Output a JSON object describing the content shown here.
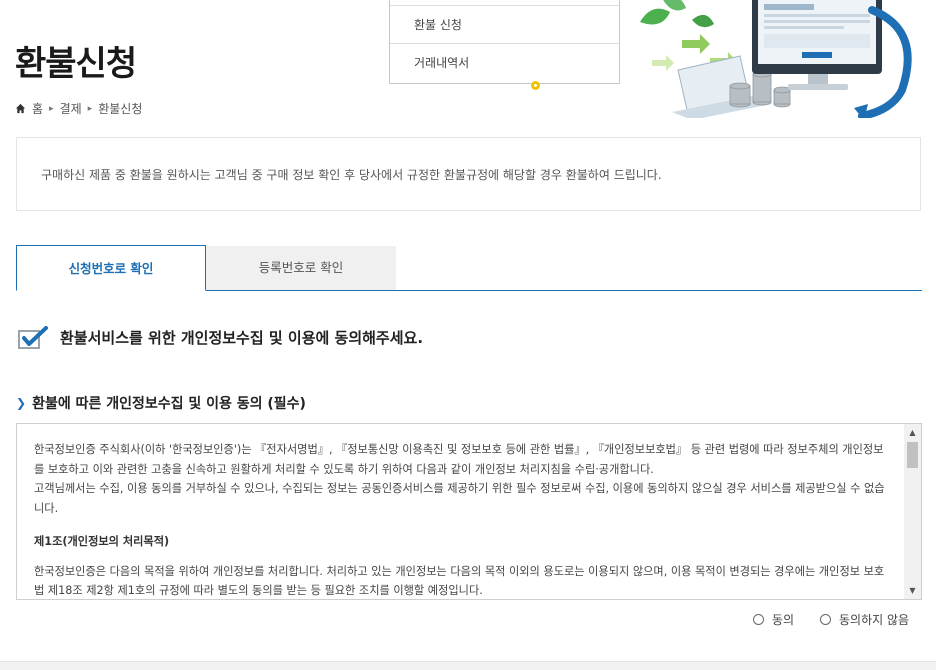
{
  "dropdown": {
    "items": [
      "환불 신청",
      "거래내역서"
    ]
  },
  "page": {
    "title": "환불신청"
  },
  "breadcrumb": {
    "items": [
      "홈",
      "결제",
      "환불신청"
    ]
  },
  "notice": {
    "text": "구매하신 제품 중 환불을 원하시는 고객님 중 구매 정보 확인 후 당사에서 규정한 환불규정에 해당할 경우 환불하여 드립니다."
  },
  "tabs": [
    {
      "label": "신청번호로 확인",
      "active": true
    },
    {
      "label": "등록번호로 확인",
      "active": false
    }
  ],
  "consent": {
    "title": "환불서비스를 위한 개인정보수집 및 이용에 동의해주세요."
  },
  "section": {
    "title": "환불에 따른 개인정보수집 및 이용 동의 (필수)"
  },
  "policy": {
    "para1": "한국정보인증 주식회사(이하 '한국정보인증')는 『전자서명법』, 『정보통신망 이용촉진 및 정보보호 등에 관한 법률』, 『개인정보보호법』 등 관련 법령에 따라 정보주체의 개인정보를 보호하고 이와 관련한 고충을 신속하고 원활하게 처리할 수 있도록 하기 위하여 다음과 같이 개인정보 처리지침을 수립·공개합니다.",
    "para2": "고객님께서는 수집, 이용 동의를 거부하실 수 있으나, 수집되는 정보는 공동인증서비스를 제공하기 위한 필수 정보로써 수집, 이용에 동의하지 않으실 경우 서비스를 제공받으실 수 없습니다.",
    "heading1": "제1조(개인정보의 처리목적)",
    "para3": "한국정보인증은 다음의 목적을 위하여 개인정보를 처리합니다. 처리하고 있는 개인정보는 다음의 목적 이외의 용도로는 이용되지 않으며, 이용 목적이 변경되는 경우에는 개인정보 보호법 제18조 제2항 제1호의 규정에 따라 별도의 동의를 받는 등 필요한 조치를 이행할 예정입니다."
  },
  "radios": {
    "agree": "동의",
    "disagree": "동의하지 않음"
  },
  "colors": {
    "accent": "#1e6fb4",
    "yellow": "#f2c200"
  }
}
